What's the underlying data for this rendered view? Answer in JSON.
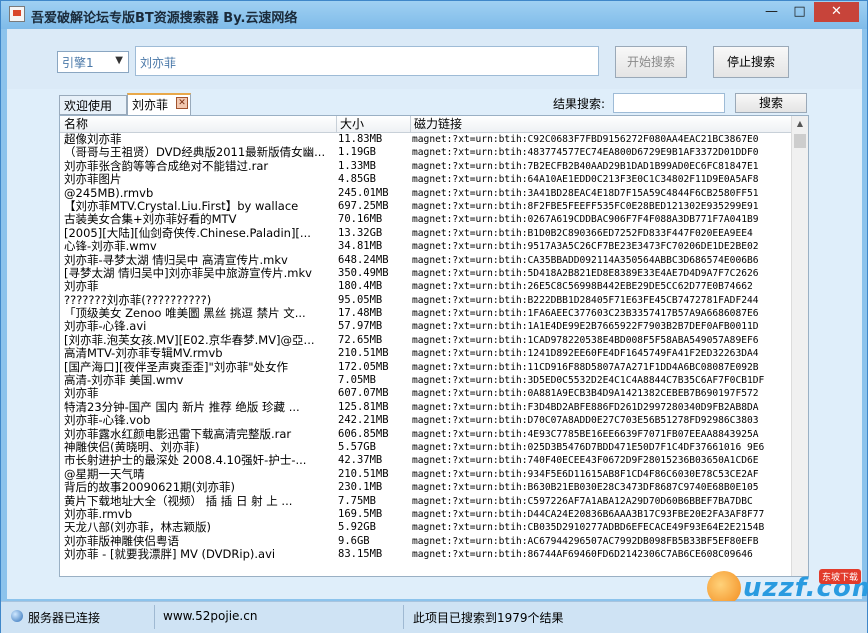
{
  "window": {
    "title": "吾爱破解论坛专版BT资源搜索器 By.云速网络",
    "minimize": "—",
    "maximize": "□",
    "close": "✕"
  },
  "toolbar": {
    "engine_value": "引擎1",
    "search_value": "刘亦菲",
    "start_label": "开始搜索",
    "stop_label": "停止搜索"
  },
  "tabs": [
    {
      "label": "欢迎使用"
    },
    {
      "label": "刘亦菲"
    }
  ],
  "filter": {
    "label": "结果搜索:",
    "value": "",
    "button_label": "搜索"
  },
  "table": {
    "columns": [
      "名称",
      "大小",
      "磁力链接"
    ],
    "rows": [
      [
        "超像刘亦菲",
        "11.83MB",
        "magnet:?xt=urn:btih:C92C0683F7FBD9156272F080AA4EAC21BC3867E0"
      ],
      [
        "（哥哥与王祖贤）DVD经典版2011最新版倩女幽...",
        "1.19GB",
        "magnet:?xt=urn:btih:483774577EC74EA800D6729E9B1AF3372D01DDF0"
      ],
      [
        "刘亦菲张含韵等等合成绝对不能错过.rar",
        "1.33MB",
        "magnet:?xt=urn:btih:7B2ECFB2B40AAD29B1DAD1B99AD0EC6FC81847E1"
      ],
      [
        "刘亦菲图片",
        "4.85GB",
        "magnet:?xt=urn:btih:64A10AE1EDD0C213F3E0C1C34802F11D9E0A5AF8"
      ],
      [
        "@245MB).rmvb",
        "245.01MB",
        "magnet:?xt=urn:btih:3A41BD28EAC4E18D7F15A59C4844F6CB2580FF51"
      ],
      [
        "【刘亦菲MTV.Crystal.Liu.First】by wallace",
        "697.25MB",
        "magnet:?xt=urn:btih:8F2FBE5FEEFF535FC0E28BED121302E935299E91"
      ],
      [
        "古装美女合集+刘亦菲好看的MTV",
        "70.16MB",
        "magnet:?xt=urn:btih:0267A619CDDBAC906F7F4F088A3DB771F7A041B9"
      ],
      [
        "[2005][大陆][仙剑奇侠传.Chinese.Paladin][...",
        "13.32GB",
        "magnet:?xt=urn:btih:B1D0B2C890366ED7252FD833F447F020EEA9EE4"
      ],
      [
        "心锋-刘亦菲.wmv",
        "34.81MB",
        "magnet:?xt=urn:btih:9517A3A5C26CF7BE23E3473FC70206DE1DE2BE02"
      ],
      [
        "刘亦菲-寻梦太湖 情归吴中 高清宣传片.mkv",
        "648.24MB",
        "magnet:?xt=urn:btih:CA35BBADD092114A350564ABBC3D686574E006B6"
      ],
      [
        "[寻梦太湖 情归吴中]刘亦菲吴中旅游宣传片.mkv",
        "350.49MB",
        "magnet:?xt=urn:btih:5D418A2B821ED8E8389E33E4AE7D4D9A7F7C2626"
      ],
      [
        "刘亦菲",
        "180.4MB",
        "magnet:?xt=urn:btih:26E5C8C56998B442EBE29DE5CC62D77E0B74662"
      ],
      [
        "???????刘亦菲(??????????)",
        "95.05MB",
        "magnet:?xt=urn:btih:B222DBB1D28405F71E63FE45CB7472781FADF244"
      ],
      [
        "「顶级美女 Zenoo 唯美圖 黑丝 挑逗 禁片 文...",
        "17.48MB",
        "magnet:?xt=urn:btih:1FA6AEEC377603C23B3357417B57A9A6686087E6"
      ],
      [
        "刘亦菲-心锋.avi",
        "57.97MB",
        "magnet:?xt=urn:btih:1A1E4DE99E2B7665922F7903B2B7DEF0AFB0011D"
      ],
      [
        "[刘亦菲.泡芙女孩.MV][E02.京华春梦.MV]@亞...",
        "72.65MB",
        "magnet:?xt=urn:btih:1CAD978220538E4BD008F5F58ABA549057A89EF6"
      ],
      [
        "高清MTV-刘亦菲专辑MV.rmvb",
        "210.51MB",
        "magnet:?xt=urn:btih:1241D892EE60FE4DF1645749FA41F2ED32263DA4"
      ],
      [
        "[国产海口][夜伴圣声爽歪歪]\"刘亦菲\"处女作",
        "172.05MB",
        "magnet:?xt=urn:btih:11CD916F88D5807A7A271F1DD4A6BC08087E092B"
      ],
      [
        "高清-刘亦菲 美国.wmv",
        "7.05MB",
        "magnet:?xt=urn:btih:3D5ED0C5532D2E4C1C4A8844C7B35C6AF7F0CB1DF"
      ],
      [
        "刘亦菲",
        "607.07MB",
        "magnet:?xt=urn:btih:0A881A9ECB3B4D9A1421382CEBEB7B690197F572"
      ],
      [
        "特清23分钟-国产 国内 新片 推荐 绝版 珍藏 ...",
        "125.81MB",
        "magnet:?xt=urn:btih:F3D4BD2ABFE886FD261D2997280340D9FB2AB8DA"
      ],
      [
        "刘亦菲-心锋.vob",
        "242.21MB",
        "magnet:?xt=urn:btih:D70C07A8ADD0E27C703E56B51278FD92986C3803"
      ],
      [
        "刘亦菲露水红颜电影迅雷下载高清完整版.rar",
        "606.85MB",
        "magnet:?xt=urn:btih:4E93C7785BE16EE6639F7071FB07EEAA8843925A"
      ],
      [
        "神雕侠侣(黄晓明、刘亦菲)",
        "5.57GB",
        "magnet:?xt=urn:btih:025D3B5476D7BDD471E50D7F1C4DF37661016 9E6"
      ],
      [
        "市长射进护士的最深处 2008.4.10强奸-护士-...",
        "42.37MB",
        "magnet:?xt=urn:btih:740F40ECEE43F0672D9F28015236B03650A1CD6E"
      ],
      [
        "@星期一天气晴",
        "210.51MB",
        "magnet:?xt=urn:btih:934F5E6D11615AB8F1CD4F86C6030E78C53CE2AF"
      ],
      [
        "背后的故事20090621期(刘亦菲)",
        "230.1MB",
        "magnet:?xt=urn:btih:B630B21EB030E28C3473DF8687C9740E68B0E105"
      ],
      [
        "黄片下载地址大全（视频） 插 插 日 射 上 ...",
        "7.75MB",
        "magnet:?xt=urn:btih:C597226AF7A1ABA12A29D70D60B6BBEF7BA7DBC"
      ],
      [
        "刘亦菲.rmvb",
        "169.5MB",
        "magnet:?xt=urn:btih:D44CA24E20836B6AAA3B17C93FBE20E2FA3AF8F77"
      ],
      [
        "天龙八部(刘亦菲，林志颖版)",
        "5.92GB",
        "magnet:?xt=urn:btih:CB035D2910277ADBD6EFECACE49F93E64E2E2154B"
      ],
      [
        "刘亦菲版神雕侠侣粤语",
        "9.6GB",
        "magnet:?xt=urn:btih:AC67944296507AC7992DB098FB5B33BF5EF80EFB"
      ],
      [
        "刘亦菲 - [就要我漂胖] MV (DVDRip).avi",
        "83.15MB",
        "magnet:?xt=urn:btih:86744AF69460FD6D2142306C7AB6CE608C09646"
      ]
    ]
  },
  "status": {
    "connection": "服务器已连接",
    "site": "www.52pojie.cn",
    "result_text": "此项目已搜索到1979个结果"
  },
  "watermark": {
    "brand": "uzzf.com",
    "tag": "东坡下载"
  }
}
